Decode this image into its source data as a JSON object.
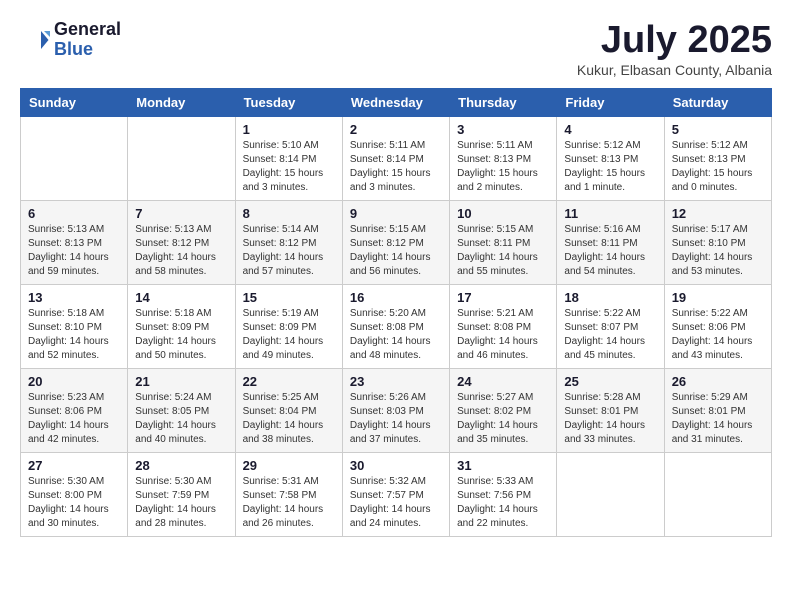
{
  "logo": {
    "general": "General",
    "blue": "Blue"
  },
  "title": {
    "month": "July 2025",
    "location": "Kukur, Elbasan County, Albania"
  },
  "headers": [
    "Sunday",
    "Monday",
    "Tuesday",
    "Wednesday",
    "Thursday",
    "Friday",
    "Saturday"
  ],
  "weeks": [
    [
      {
        "day": "",
        "sunrise": "",
        "sunset": "",
        "daylight": ""
      },
      {
        "day": "",
        "sunrise": "",
        "sunset": "",
        "daylight": ""
      },
      {
        "day": "1",
        "sunrise": "Sunrise: 5:10 AM",
        "sunset": "Sunset: 8:14 PM",
        "daylight": "Daylight: 15 hours and 3 minutes."
      },
      {
        "day": "2",
        "sunrise": "Sunrise: 5:11 AM",
        "sunset": "Sunset: 8:14 PM",
        "daylight": "Daylight: 15 hours and 3 minutes."
      },
      {
        "day": "3",
        "sunrise": "Sunrise: 5:11 AM",
        "sunset": "Sunset: 8:13 PM",
        "daylight": "Daylight: 15 hours and 2 minutes."
      },
      {
        "day": "4",
        "sunrise": "Sunrise: 5:12 AM",
        "sunset": "Sunset: 8:13 PM",
        "daylight": "Daylight: 15 hours and 1 minute."
      },
      {
        "day": "5",
        "sunrise": "Sunrise: 5:12 AM",
        "sunset": "Sunset: 8:13 PM",
        "daylight": "Daylight: 15 hours and 0 minutes."
      }
    ],
    [
      {
        "day": "6",
        "sunrise": "Sunrise: 5:13 AM",
        "sunset": "Sunset: 8:13 PM",
        "daylight": "Daylight: 14 hours and 59 minutes."
      },
      {
        "day": "7",
        "sunrise": "Sunrise: 5:13 AM",
        "sunset": "Sunset: 8:12 PM",
        "daylight": "Daylight: 14 hours and 58 minutes."
      },
      {
        "day": "8",
        "sunrise": "Sunrise: 5:14 AM",
        "sunset": "Sunset: 8:12 PM",
        "daylight": "Daylight: 14 hours and 57 minutes."
      },
      {
        "day": "9",
        "sunrise": "Sunrise: 5:15 AM",
        "sunset": "Sunset: 8:12 PM",
        "daylight": "Daylight: 14 hours and 56 minutes."
      },
      {
        "day": "10",
        "sunrise": "Sunrise: 5:15 AM",
        "sunset": "Sunset: 8:11 PM",
        "daylight": "Daylight: 14 hours and 55 minutes."
      },
      {
        "day": "11",
        "sunrise": "Sunrise: 5:16 AM",
        "sunset": "Sunset: 8:11 PM",
        "daylight": "Daylight: 14 hours and 54 minutes."
      },
      {
        "day": "12",
        "sunrise": "Sunrise: 5:17 AM",
        "sunset": "Sunset: 8:10 PM",
        "daylight": "Daylight: 14 hours and 53 minutes."
      }
    ],
    [
      {
        "day": "13",
        "sunrise": "Sunrise: 5:18 AM",
        "sunset": "Sunset: 8:10 PM",
        "daylight": "Daylight: 14 hours and 52 minutes."
      },
      {
        "day": "14",
        "sunrise": "Sunrise: 5:18 AM",
        "sunset": "Sunset: 8:09 PM",
        "daylight": "Daylight: 14 hours and 50 minutes."
      },
      {
        "day": "15",
        "sunrise": "Sunrise: 5:19 AM",
        "sunset": "Sunset: 8:09 PM",
        "daylight": "Daylight: 14 hours and 49 minutes."
      },
      {
        "day": "16",
        "sunrise": "Sunrise: 5:20 AM",
        "sunset": "Sunset: 8:08 PM",
        "daylight": "Daylight: 14 hours and 48 minutes."
      },
      {
        "day": "17",
        "sunrise": "Sunrise: 5:21 AM",
        "sunset": "Sunset: 8:08 PM",
        "daylight": "Daylight: 14 hours and 46 minutes."
      },
      {
        "day": "18",
        "sunrise": "Sunrise: 5:22 AM",
        "sunset": "Sunset: 8:07 PM",
        "daylight": "Daylight: 14 hours and 45 minutes."
      },
      {
        "day": "19",
        "sunrise": "Sunrise: 5:22 AM",
        "sunset": "Sunset: 8:06 PM",
        "daylight": "Daylight: 14 hours and 43 minutes."
      }
    ],
    [
      {
        "day": "20",
        "sunrise": "Sunrise: 5:23 AM",
        "sunset": "Sunset: 8:06 PM",
        "daylight": "Daylight: 14 hours and 42 minutes."
      },
      {
        "day": "21",
        "sunrise": "Sunrise: 5:24 AM",
        "sunset": "Sunset: 8:05 PM",
        "daylight": "Daylight: 14 hours and 40 minutes."
      },
      {
        "day": "22",
        "sunrise": "Sunrise: 5:25 AM",
        "sunset": "Sunset: 8:04 PM",
        "daylight": "Daylight: 14 hours and 38 minutes."
      },
      {
        "day": "23",
        "sunrise": "Sunrise: 5:26 AM",
        "sunset": "Sunset: 8:03 PM",
        "daylight": "Daylight: 14 hours and 37 minutes."
      },
      {
        "day": "24",
        "sunrise": "Sunrise: 5:27 AM",
        "sunset": "Sunset: 8:02 PM",
        "daylight": "Daylight: 14 hours and 35 minutes."
      },
      {
        "day": "25",
        "sunrise": "Sunrise: 5:28 AM",
        "sunset": "Sunset: 8:01 PM",
        "daylight": "Daylight: 14 hours and 33 minutes."
      },
      {
        "day": "26",
        "sunrise": "Sunrise: 5:29 AM",
        "sunset": "Sunset: 8:01 PM",
        "daylight": "Daylight: 14 hours and 31 minutes."
      }
    ],
    [
      {
        "day": "27",
        "sunrise": "Sunrise: 5:30 AM",
        "sunset": "Sunset: 8:00 PM",
        "daylight": "Daylight: 14 hours and 30 minutes."
      },
      {
        "day": "28",
        "sunrise": "Sunrise: 5:30 AM",
        "sunset": "Sunset: 7:59 PM",
        "daylight": "Daylight: 14 hours and 28 minutes."
      },
      {
        "day": "29",
        "sunrise": "Sunrise: 5:31 AM",
        "sunset": "Sunset: 7:58 PM",
        "daylight": "Daylight: 14 hours and 26 minutes."
      },
      {
        "day": "30",
        "sunrise": "Sunrise: 5:32 AM",
        "sunset": "Sunset: 7:57 PM",
        "daylight": "Daylight: 14 hours and 24 minutes."
      },
      {
        "day": "31",
        "sunrise": "Sunrise: 5:33 AM",
        "sunset": "Sunset: 7:56 PM",
        "daylight": "Daylight: 14 hours and 22 minutes."
      },
      {
        "day": "",
        "sunrise": "",
        "sunset": "",
        "daylight": ""
      },
      {
        "day": "",
        "sunrise": "",
        "sunset": "",
        "daylight": ""
      }
    ]
  ]
}
